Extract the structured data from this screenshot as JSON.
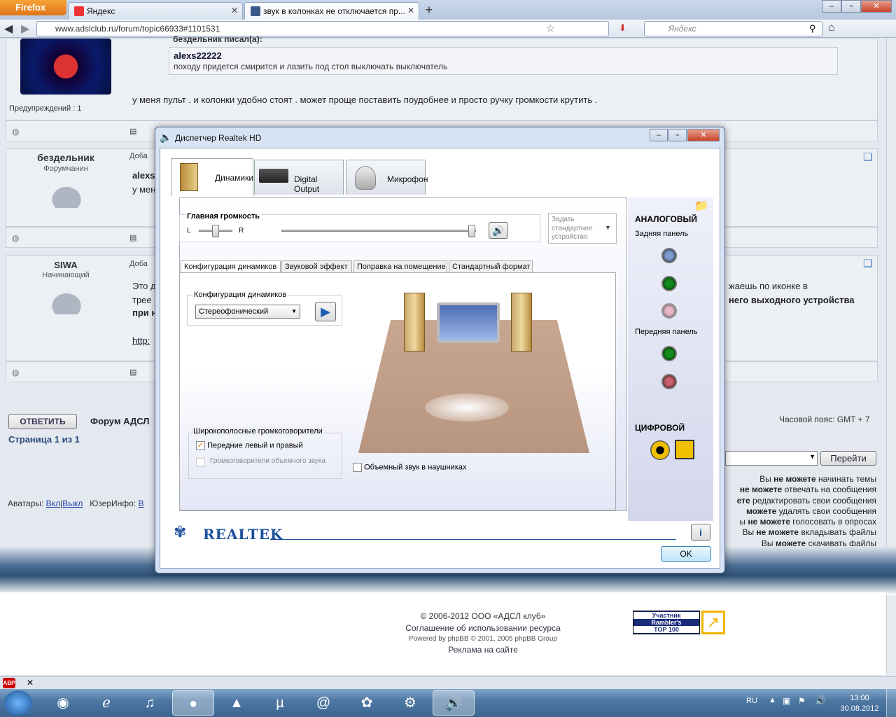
{
  "browser": {
    "app_button": "Firefox",
    "tabs": [
      {
        "label": "Яндекс"
      },
      {
        "label": "звук в колонках не отключается пр..."
      }
    ],
    "url": "www.adslclub.ru/forum/topic66933#1101531",
    "search_placeholder": "Яндекс"
  },
  "forum": {
    "post1": {
      "quote_intro": "бездельник писал(а):",
      "quote_author": "alexs22222",
      "quote_text": "походу придется смирится и лазить под стол выключать выключатель",
      "warnings": "Предупреждений : 1",
      "text": "у меня пульт . и колонки удобно стоят . может проще поставить поудобнее и просто ручку громкости крутить ."
    },
    "post2": {
      "username": "бездельник",
      "rank": "Форумчанин",
      "added": "Доба",
      "line1": "alexs",
      "line2": "у мен"
    },
    "post3": {
      "username": "SIWA",
      "rank": "Начинающий",
      "added": "Доба",
      "line1": "Это д",
      "line2": "трее",
      "line3": "при н",
      "link": "http:",
      "right1": "жаешь по иконке в",
      "right2": "него выходного устройства"
    },
    "reply_button": "ОТВЕТИТЬ",
    "forum_name": "Форум АДСЛ",
    "page_info": "Страница 1 из 1",
    "timezone": "Часовой пояс: GMT + 7",
    "goto_button": "Перейти",
    "avatars": "Аватары:",
    "avatars_on": "Вкл",
    "avatars_off": "Выкл",
    "userinfo": "ЮзерИнфо:",
    "userinfo_v": "В",
    "perms": [
      {
        "a": "Вы ",
        "b": "не можете",
        "c": " начинать темы"
      },
      {
        "a": "",
        "b": "не можете",
        "c": " отвечать на сообщения"
      },
      {
        "a": "",
        "b": "ете",
        "c": " редактировать свои сообщения"
      },
      {
        "a": "",
        "b": "можете",
        "c": " удалять свои сообщения"
      },
      {
        "a": "ы ",
        "b": "не можете",
        "c": " голосовать в опросах"
      },
      {
        "a": "Вы ",
        "b": "не можете",
        "c": " вкладывать файлы"
      },
      {
        "a": "Вы ",
        "b": "можете",
        "c": " скачивать файлы"
      }
    ],
    "footer": {
      "copyright": "© 2006-2012 ООО «АДСЛ клуб»",
      "agreement": "Соглашение об использовании ресурса",
      "powered": "Powered by phpBB © 2001, 2005 phpBB Group",
      "ads": "Реклама на сайте",
      "rambler1": "Участник",
      "rambler2": "Rambler's",
      "rambler3": "TOP 100"
    }
  },
  "dialog": {
    "title": "Диспетчер Realtek HD",
    "tabs": [
      "Динамики",
      "Digital Output",
      "Микрофон"
    ],
    "main_volume": "Главная громкость",
    "left": "L",
    "right": "R",
    "balance": 0.5,
    "volume": 1.0,
    "default_device": "Задать стандартное устройство",
    "subtabs": [
      "Конфигурация динамиков",
      "Звуковой эффект",
      "Поправка на помещение",
      "Стандартный формат"
    ],
    "config_group": "Конфигурация динамиков",
    "config_value": "Стереофонический",
    "wideband_group": "Широкополосные громкоговорители",
    "front_lr": "Передние левый и правый",
    "surround_spk": "Громкоговорители объемного звука",
    "headphones": "Объемный звук в наушниках",
    "analog": "АНАЛОГОВЫЙ",
    "rear_panel": "Задняя панель",
    "front_panel": "Передняя панель",
    "digital": "ЦИФРОВОЙ",
    "ok": "OK",
    "brand": "REALTEK"
  },
  "taskbar": {
    "lang": "RU",
    "time": "13:00",
    "date": "30.08.2012"
  },
  "colors": {
    "jack_blue": "#7e9bd0",
    "jack_green": "#138a1c",
    "jack_pink": "#e7a6b4",
    "jack_red": "#c9606e"
  }
}
